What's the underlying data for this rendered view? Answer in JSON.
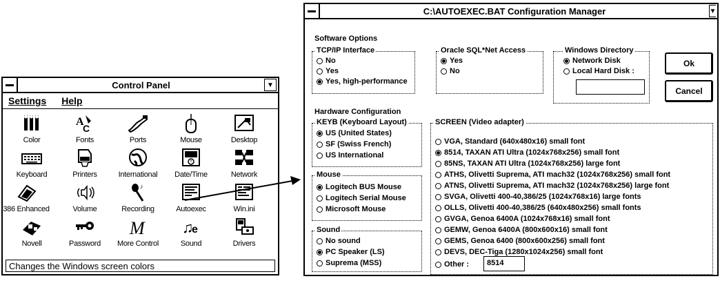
{
  "control_panel": {
    "title": "Control Panel",
    "menu": [
      "Settings",
      "Help"
    ],
    "icons": [
      {
        "label": "Color",
        "icon": "color-palette-icon"
      },
      {
        "label": "Fonts",
        "icon": "fonts-icon"
      },
      {
        "label": "Ports",
        "icon": "ports-icon"
      },
      {
        "label": "Mouse",
        "icon": "mouse-icon"
      },
      {
        "label": "Desktop",
        "icon": "desktop-icon"
      },
      {
        "label": "Keyboard",
        "icon": "keyboard-icon"
      },
      {
        "label": "Printers",
        "icon": "printer-icon"
      },
      {
        "label": "International",
        "icon": "globe-icon"
      },
      {
        "label": "Date/Time",
        "icon": "clock-icon"
      },
      {
        "label": "Network",
        "icon": "network-icon"
      },
      {
        "label": "386 Enhanced",
        "icon": "chip-icon"
      },
      {
        "label": "Volume",
        "icon": "speaker-icon"
      },
      {
        "label": "Recording",
        "icon": "microphone-icon"
      },
      {
        "label": "Autoexec",
        "icon": "autoexec-icon"
      },
      {
        "label": "Win.ini",
        "icon": "winini-icon"
      },
      {
        "label": "Novell",
        "icon": "novell-icon"
      },
      {
        "label": "Password",
        "icon": "key-icon"
      },
      {
        "label": "More Control",
        "icon": "more-control-icon"
      },
      {
        "label": "Sound",
        "icon": "music-note-icon"
      },
      {
        "label": "Drivers",
        "icon": "drivers-icon"
      }
    ],
    "status": "Changes the Windows screen colors"
  },
  "config": {
    "title": "C:\\AUTOEXEC.BAT Configuration Manager",
    "software_heading": "Software Options",
    "tcpip": {
      "label": "TCP/IP Interface",
      "options": [
        "No",
        "Yes",
        "Yes, high-performance"
      ],
      "selected": 2
    },
    "oracle": {
      "label": "Oracle SQL*Net Access",
      "options": [
        "Yes",
        "No"
      ],
      "selected": 0
    },
    "windir": {
      "label": "Windows Directory",
      "options": [
        "Network Disk",
        "Local Hard Disk :"
      ],
      "selected": 0,
      "path_value": ""
    },
    "ok_label": "Ok",
    "cancel_label": "Cancel",
    "hardware_heading": "Hardware Configuration",
    "keyb": {
      "label": "KEYB (Keyboard Layout)",
      "options": [
        "US (United States)",
        "SF (Swiss French)",
        "US International"
      ],
      "selected": 0
    },
    "mouse": {
      "label": "Mouse",
      "options": [
        "Logitech BUS Mouse",
        "Logitech Serial Mouse",
        "Microsoft Mouse"
      ],
      "selected": 0
    },
    "sound": {
      "label": "Sound",
      "options": [
        "No sound",
        "PC Speaker (LS)",
        "Suprema (MSS)"
      ],
      "selected": 1
    },
    "screen": {
      "label": "SCREEN (Video adapter)",
      "options": [
        "VGA, Standard (640x480x16) small font",
        "8514, TAXAN ATI Ultra (1024x768x256) small font",
        "85NS, TAXAN ATI Ultra (1024x768x256) large font",
        "ATHS, Olivetti Suprema, ATI mach32 (1024x768x256) small font",
        "ATNS, Olivetti Suprema, ATI mach32 (1024x768x256) large font",
        "SVGA, Olivetti 400-40,386/25 (1024x768x16) large fonts",
        "OLLS, Olivetti 400-40,386/25 (640x480x256) small fonts",
        "GVGA, Genoa 6400A (1024x768x16) small font",
        "GEMW, Genoa 6400A (800x600x16) small font",
        "GEMS, Genoa 6400 (800x600x256) small font",
        "DEVS, DEC-Tiga (1280x1024x256) small font",
        "Other :"
      ],
      "selected": 1,
      "other_value": "8514"
    }
  }
}
